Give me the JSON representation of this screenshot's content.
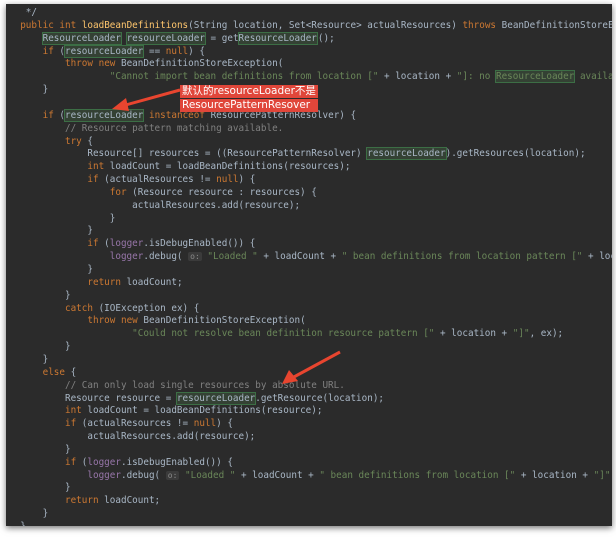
{
  "code_lines": [
    "   */",
    "  public int loadBeanDefinitions(String location, Set<Resource> actualResources) throws BeanDefinitionStoreException {",
    "      ResourceLoader resourceLoader = getResourceLoader();",
    "      if (resourceLoader == null) {",
    "          throw new BeanDefinitionStoreException(",
    "                  \"Cannot import bean definitions from location [\" + location + \"]: no ResourceLoader available\");",
    "      }",
    "",
    "      if (resourceLoader instanceof ResourcePatternResolver) {",
    "          // Resource pattern matching available.",
    "          try {",
    "              Resource[] resources = ((ResourcePatternResolver) resourceLoader).getResources(location);",
    "              int loadCount = loadBeanDefinitions(resources);",
    "              if (actualResources != null) {",
    "                  for (Resource resource : resources) {",
    "                      actualResources.add(resource);",
    "                  }",
    "              }",
    "              if (logger.isDebugEnabled()) {",
    "                  logger.debug( \"Loaded \" + loadCount + \" bean definitions from location pattern [\" + location + \"]\");",
    "              }",
    "              return loadCount;",
    "          }",
    "          catch (IOException ex) {",
    "              throw new BeanDefinitionStoreException(",
    "                      \"Could not resolve bean definition resource pattern [\" + location + \"]\", ex);",
    "          }",
    "      }",
    "      else {",
    "          // Can only load single resources by absolute URL.",
    "          Resource resource = resourceLoader.getResource(location);",
    "          int loadCount = loadBeanDefinitions(resource);",
    "          if (actualResources != null) {",
    "              actualResources.add(resource);",
    "          }",
    "          if (logger.isDebugEnabled()) {",
    "              logger.debug( \"Loaded \" + loadCount + \" bean definitions from location [\" + location + \"]\");",
    "          }",
    "          return loadCount;",
    "      }",
    "  }"
  ],
  "inlay_hint": "o:",
  "annotation": {
    "line1": "默认的resourceLoader不是",
    "line2": "ResourcePatternResover"
  },
  "colors": {
    "editor_background": "#2b2b2b",
    "keyword": "#cc7832",
    "string": "#6a8759",
    "comment": "#808080",
    "method_declaration": "#ffc66d",
    "usage_highlight": "#344134",
    "annotation_background": "#e0463a",
    "arrow": "#e8452f"
  }
}
